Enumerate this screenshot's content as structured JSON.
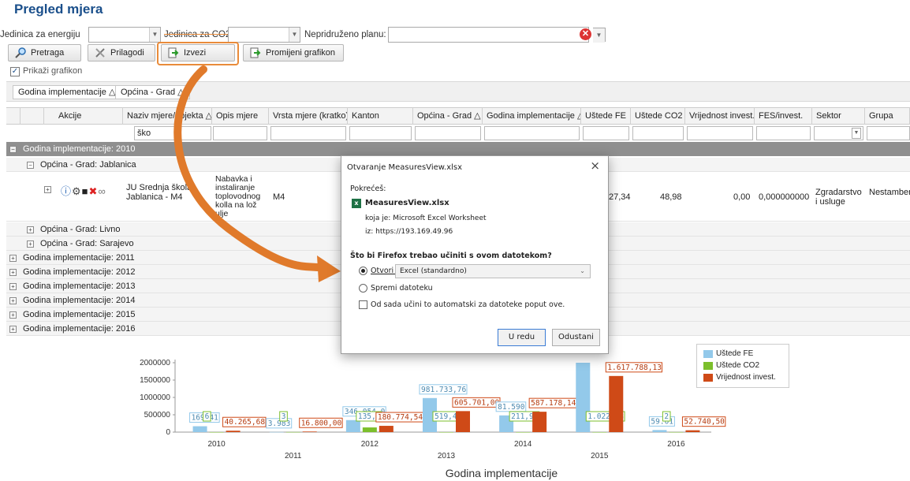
{
  "page": {
    "title": "Pregled mjera"
  },
  "filters": {
    "energy_label": "Jedinica za energiju",
    "co2_label": "Jedinica za CO2",
    "plan_label": "Nepridruženo planu:"
  },
  "toolbar": {
    "search": "Pretraga",
    "customize": "Prilagodi",
    "export": "Izvezi",
    "change_chart": "Promijeni grafikon",
    "show_chart": "Prikaži grafikon"
  },
  "grouping": {
    "chip1": "Godina implementacije △",
    "chip2": "Općina - Grad △"
  },
  "columns": {
    "actions": "Akcije",
    "name": "Naziv mjere/objekta △",
    "desc": "Opis mjere",
    "type": "Vrsta mjere (kratko)",
    "canton": "Kanton",
    "city": "Općina - Grad △",
    "year": "Godina implementacije △",
    "fe": "Uštede FE",
    "co2": "Uštede CO2",
    "invest": "Vrijednost invest.",
    "fes_inv": "FES/invest.",
    "sector": "Sektor",
    "group": "Grupa"
  },
  "filter_row": {
    "name": "ško"
  },
  "rows": {
    "g2010": "Godina implementacije: 2010",
    "jablanica": "Općina - Grad: Jablanica",
    "livno": "Općina - Grad: Livno",
    "sarajevo": "Općina - Grad: Sarajevo",
    "g2011": "Godina implementacije: 2011",
    "g2012": "Godina implementacije: 2012",
    "g2013": "Godina implementacije: 2013",
    "g2014": "Godina implementacije: 2014",
    "g2015": "Godina implementacije: 2015",
    "g2016": "Godina implementacije: 2016"
  },
  "record": {
    "name": "JU Srednja škola, Jablanica - M4",
    "desc": "Nabavka i instaliranje toplovodnog kolla na lož ulje",
    "type": "M4",
    "fe": "27,34",
    "co2": "48,98",
    "invest": "0,00",
    "fes_inv": "0,000000000",
    "sector": "Zgradarstvo i usluge",
    "group": "Nestamben - javni"
  },
  "dialog": {
    "title": "Otvaranje MeasuresView.xlsx",
    "started": "Pokrećeš:",
    "file": "MeasuresView.xlsx",
    "type_line": "koja je: Microsoft Excel Worksheet",
    "from_line": "iz: https://193.169.49.96",
    "question": "Što bi Firefox trebao učiniti s ovom datotekom?",
    "open_with": "Otvori s",
    "app": "Excel (standardno)",
    "save": "Spremi datoteku",
    "auto": "Od sada učini to automatski za datoteke poput ove.",
    "ok": "U redu",
    "cancel": "Odustani",
    "close": "×"
  },
  "colors": {
    "fe": "#93c9ea",
    "co2": "#7cbf2c",
    "invest": "#cf4a17",
    "accent": "#e98b3a"
  },
  "chart_data": {
    "type": "bar",
    "xlabel": "Godina implementacije",
    "categories": [
      "2010",
      "2011",
      "2012",
      "2013",
      "2014",
      "2015",
      "2016"
    ],
    "ylim": [
      0,
      2000000
    ],
    "yticks": [
      "2000000",
      "1500000",
      "1000000",
      "500000",
      "0"
    ],
    "series": [
      {
        "name": "Uštede FE",
        "values": [
          169416,
          3983,
          346054,
          981733.76,
          481590,
          2000000,
          59012
        ],
        "labels": [
          "169.41",
          "3.983",
          "346.054,0",
          "981.733,76",
          "81.590",
          "",
          "59.01"
        ]
      },
      {
        "name": "Uštede CO2",
        "values": [
          600,
          3000,
          135000,
          519.44,
          211.97,
          1022.13,
          2000
        ],
        "labels": [
          "6",
          "3",
          "135,2",
          "519,44",
          "211,97",
          "1.022,13",
          "2"
        ]
      },
      {
        "name": "Vrijednost invest.",
        "values": [
          40265.68,
          16800,
          180774.54,
          605701,
          587178.14,
          1617788.13,
          52740.5
        ],
        "labels": [
          "40.265,68",
          "16.800,00",
          "180.774,54",
          "605.701,00",
          "587.178,14",
          "1.617.788,13",
          "52.740,50"
        ]
      }
    ]
  }
}
